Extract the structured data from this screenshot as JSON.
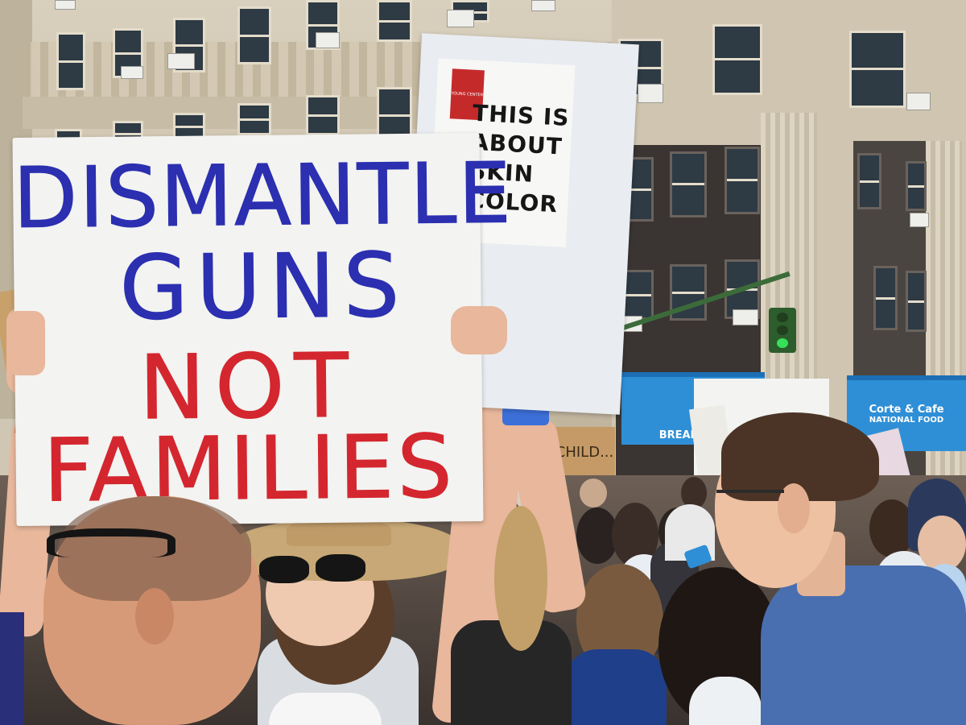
{
  "scene": {
    "description_type": "street-protest-photo"
  },
  "main_sign": {
    "line1": "DISMANTLE",
    "line2": "GUNS",
    "line3": "NOT",
    "line4": "FAMILIES",
    "colors": {
      "top": "#2b2fb0",
      "bottom": "#d4262e",
      "board": "#f3f3f1"
    }
  },
  "secondary_sign": {
    "lines": [
      "THIS IS",
      "ABOUT",
      "SKIN",
      "COLOR"
    ],
    "logo_text": "YOUNG CENTER",
    "colors": {
      "logo": "#c52a2a",
      "text": "#161616"
    }
  },
  "background_signs": {
    "cardboard": "CHILD...",
    "awning_left": "BREAKFAST",
    "awning_right": "Corte & Cafe",
    "awning_right_sub": "NATIONAL FOOD"
  },
  "colors": {
    "awning": "#2f8fd6",
    "traffic_light_green": "#36e05a",
    "pole": "#3c6b3a"
  }
}
